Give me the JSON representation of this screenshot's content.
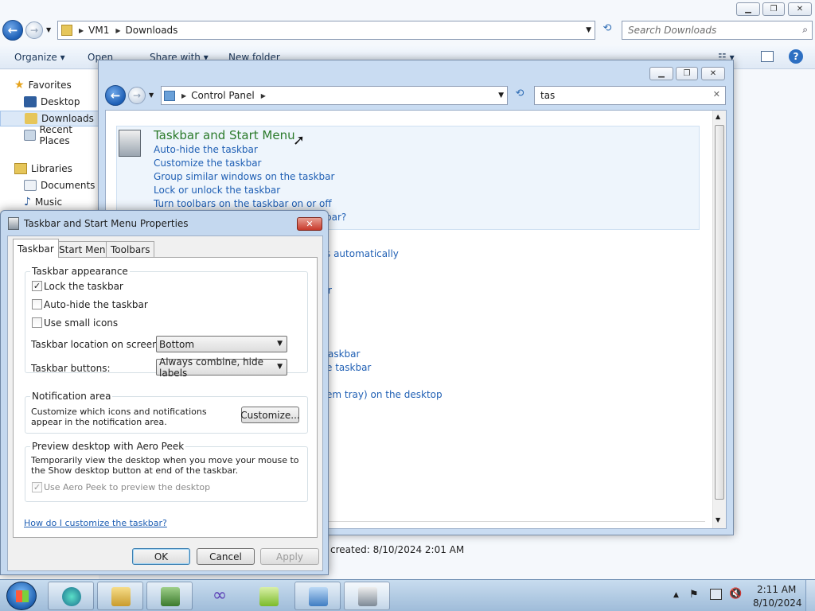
{
  "explorer": {
    "breadcrumb": [
      "VM1",
      "Downloads"
    ],
    "search_placeholder": "Search Downloads",
    "commands": [
      "Organize",
      "Open",
      "Share with",
      "New folder"
    ],
    "nav": {
      "favorites": "Favorites",
      "desktop": "Desktop",
      "downloads": "Downloads",
      "recent": "Recent Places",
      "libraries": "Libraries",
      "documents": "Documents",
      "music": "Music"
    },
    "details_created": "created:  8/10/2024 2:01 AM"
  },
  "control_panel": {
    "breadcrumb": [
      "Control Panel"
    ],
    "search_value": "tas",
    "result_title": "Taskbar and Start Menu",
    "tasks": [
      "Auto-hide the taskbar",
      "Customize the taskbar",
      "Group similar windows on the taskbar",
      "Lock or unlock the taskbar",
      "Turn toolbars on the taskbar on or off"
    ],
    "partial_links": [
      "bar?",
      "s automatically",
      "r",
      "askbar",
      "e taskbar",
      "em tray) on the desktop"
    ]
  },
  "dialog": {
    "title": "Taskbar and Start Menu Properties",
    "tabs": [
      "Taskbar",
      "Start Menu",
      "Toolbars"
    ],
    "appearance": {
      "title": "Taskbar appearance",
      "lock": "Lock the taskbar",
      "autohide": "Auto-hide the taskbar",
      "small_icons": "Use small icons",
      "location_label": "Taskbar location on screen:",
      "location_value": "Bottom",
      "buttons_label": "Taskbar buttons:",
      "buttons_value": "Always combine, hide labels"
    },
    "notification": {
      "title": "Notification area",
      "text": "Customize which icons and notifications appear in the notification area.",
      "customize_button": "Customize..."
    },
    "aero": {
      "title": "Preview desktop with Aero Peek",
      "text": "Temporarily view the desktop when you move your mouse to the Show desktop button at end of the taskbar.",
      "checkbox": "Use Aero Peek to preview the desktop"
    },
    "help_link": "How do I customize the taskbar?",
    "buttons": {
      "ok": "OK",
      "cancel": "Cancel",
      "apply": "Apply"
    }
  },
  "taskbar": {
    "time": "2:11 AM",
    "date": "8/10/2024"
  },
  "colors": {
    "link": "#1f5fb4",
    "title_green": "#2a7a2a",
    "close_red": "#c7392a"
  }
}
